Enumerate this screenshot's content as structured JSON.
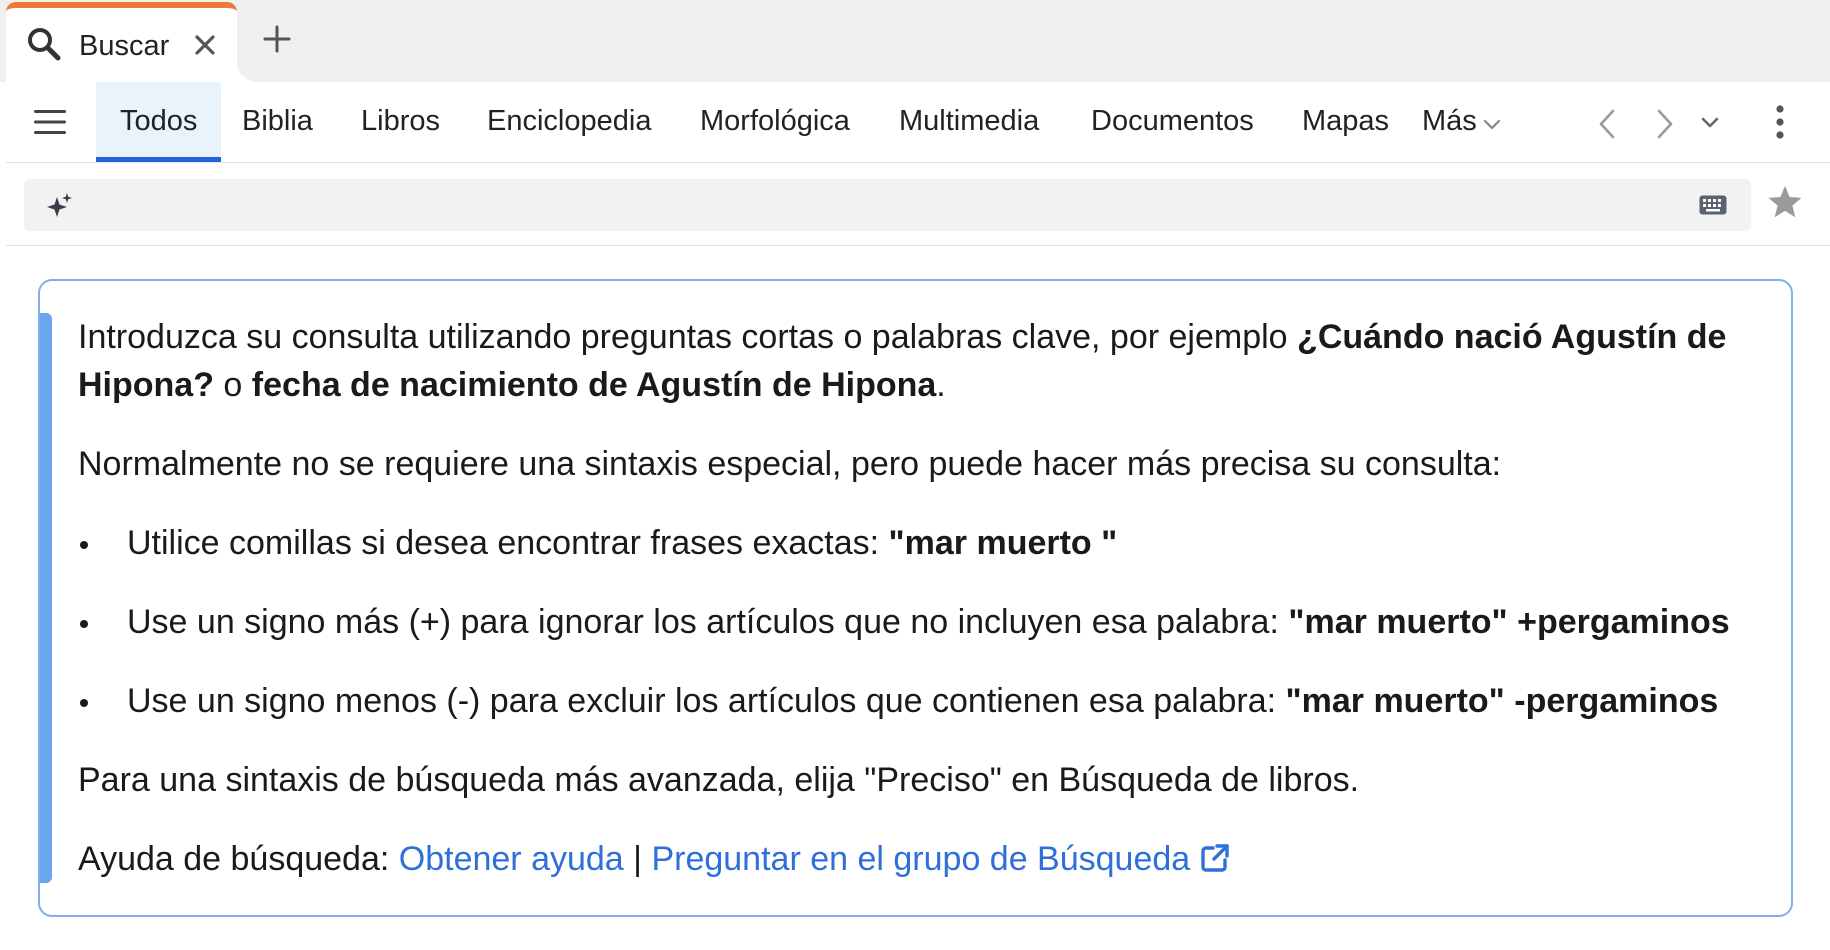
{
  "tab": {
    "label": "Buscar",
    "icon": "search-icon",
    "accent_color": "#ee7a3a"
  },
  "nav": {
    "tabs": [
      {
        "label": "Todos",
        "active": true
      },
      {
        "label": "Biblia"
      },
      {
        "label": "Libros"
      },
      {
        "label": "Enciclopedia"
      },
      {
        "label": "Morfológica"
      },
      {
        "label": "Multimedia"
      },
      {
        "label": "Documentos"
      },
      {
        "label": "Mapas"
      },
      {
        "label": "Más"
      }
    ],
    "active_color": "#2561d9"
  },
  "search": {
    "placeholder": "",
    "value": ""
  },
  "help": {
    "intro_prefix": "Introduzca su consulta utilizando preguntas cortas o palabras clave, por ejemplo ",
    "intro_example1": "¿Cuándo nació Agustín de Hipona?",
    "intro_or": " o ",
    "intro_example2": "fecha de nacimiento de Agustín de Hipona",
    "intro_end": ".",
    "syntax_note": "Normalmente no se requiere una sintaxis especial, pero puede hacer más precisa su consulta:",
    "tips": [
      {
        "text": "Utilice comillas si desea encontrar frases exactas: ",
        "example": "\"mar muerto \""
      },
      {
        "text": "Use un signo más (+) para ignorar los artículos que no incluyen esa palabra: ",
        "example": "\"mar muerto\" +pergaminos"
      },
      {
        "text": "Use un signo menos (-) para excluir los artículos que contienen esa palabra: ",
        "example": "\"mar muerto\" -pergaminos"
      }
    ],
    "advanced": "Para una sintaxis de búsqueda más avanzada, elija \"Preciso\" en Búsqueda de libros.",
    "help_label": "Ayuda de búsqueda: ",
    "link_help": "Obtener ayuda",
    "separator": "|",
    "link_group": "Preguntar en el grupo de Búsqueda",
    "link_color": "#2f6fd8",
    "border_color": "#7fb0ea"
  }
}
